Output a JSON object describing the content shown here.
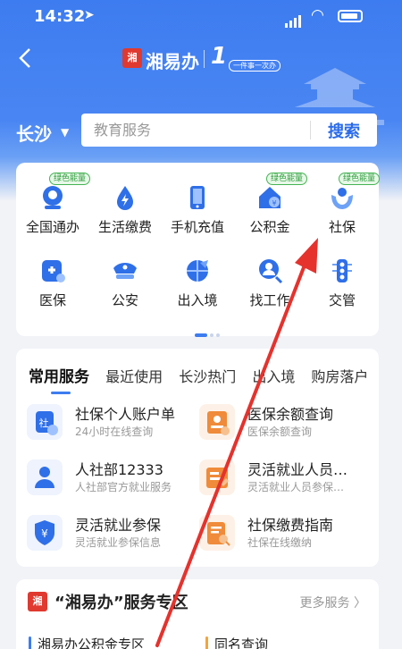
{
  "status_bar": {
    "time": "14:32"
  },
  "header": {
    "logo_text": "湘",
    "app_name": "湘易办",
    "slogan_number": "1",
    "slogan_text": "一件事一次办"
  },
  "search": {
    "city": "长沙",
    "placeholder": "教育服务",
    "button": "搜索"
  },
  "services": [
    {
      "label": "全国通办",
      "badge": "绿色能量",
      "icon": "globe-person-icon"
    },
    {
      "label": "生活缴费",
      "badge": "",
      "icon": "lightning-drop-icon"
    },
    {
      "label": "手机充值",
      "badge": "",
      "icon": "phone-icon"
    },
    {
      "label": "公积金",
      "badge": "绿色能量",
      "icon": "house-fund-icon"
    },
    {
      "label": "社保",
      "badge": "绿色能量",
      "icon": "hands-person-icon"
    },
    {
      "label": "医保",
      "badge": "",
      "icon": "medical-shield-icon"
    },
    {
      "label": "公安",
      "badge": "",
      "icon": "police-cap-icon"
    },
    {
      "label": "出入境",
      "badge": "",
      "icon": "globe-plane-icon"
    },
    {
      "label": "找工作",
      "badge": "",
      "icon": "search-person-icon"
    },
    {
      "label": "交管",
      "badge": "",
      "icon": "traffic-light-icon"
    }
  ],
  "common": {
    "tabs": [
      "常用服务",
      "最近使用",
      "长沙热门",
      "出入境",
      "购房落户"
    ],
    "items": [
      {
        "title": "社保个人账户单",
        "subtitle": "24小时在线查询",
        "icon": "social-security-icon"
      },
      {
        "title": "医保余额查询",
        "subtitle": "医保余额查询",
        "icon": "medical-card-icon"
      },
      {
        "title": "人社部12333",
        "subtitle": "人社部官方就业服务",
        "icon": "person-icon"
      },
      {
        "title": "灵活就业人员…",
        "subtitle": "灵活就业人员参保…",
        "icon": "id-card-icon"
      },
      {
        "title": "灵活就业参保",
        "subtitle": "灵活就业参保信息",
        "icon": "yen-shield-icon"
      },
      {
        "title": "社保缴费指南",
        "subtitle": "社保在线缴纳",
        "icon": "doc-search-icon"
      }
    ]
  },
  "zone": {
    "logo_text": "湘",
    "title": "“湘易办”服务专区",
    "more": "更多服务 〉",
    "sub_left": "湘易办公积金专区",
    "sub_right": "同名查询"
  },
  "colors": {
    "primary": "#3d7cf0",
    "accent_red": "#e0392f",
    "badge_green": "#46b454",
    "arrow": "#e5322d"
  }
}
